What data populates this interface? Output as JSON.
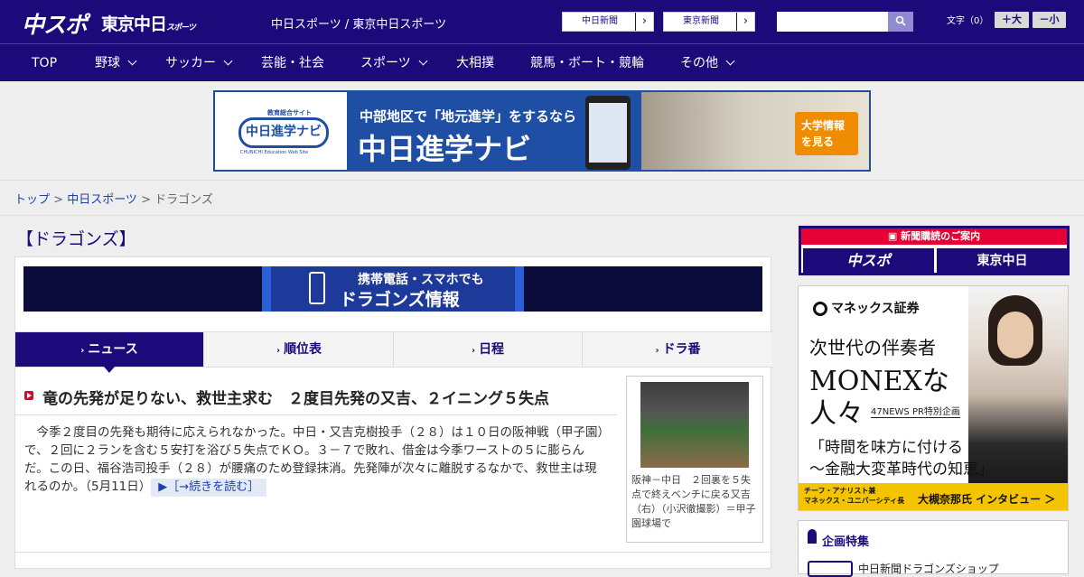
{
  "header": {
    "logo_chunichi": "中スポ",
    "logo_tokyo": "東京中日",
    "logo_tokyo_small": "スポーツ",
    "site_name": "中日スポーツ / 東京中日スポーツ",
    "btn_chunichi_shimbun": "中日新聞",
    "btn_tokyo_shimbun": "東京新聞",
    "search_placeholder": "",
    "text_size_label": "文字（0）",
    "text_bigger": "＋大",
    "text_smaller": "－小"
  },
  "nav": {
    "items": [
      {
        "label": "TOP"
      },
      {
        "label": "野球"
      },
      {
        "label": "サッカー"
      },
      {
        "label": "芸能・社会"
      },
      {
        "label": "スポーツ"
      },
      {
        "label": "大相撲"
      },
      {
        "label": "競馬・ボート・競輪"
      },
      {
        "label": "その他"
      }
    ]
  },
  "banner": {
    "logo": "中日進学ナビ",
    "logo_caption": "教育総合サイト",
    "logo_sub": "CHUNICHI Education Web Site",
    "catch": "中部地区で「地元進学」をするなら",
    "title": "中日進学ナビ",
    "cta": "大学情報\nを見る"
  },
  "breadcrumb": {
    "home": "トップ",
    "sep1": " > ",
    "section": "中日スポーツ",
    "sep2": " > ",
    "current": "ドラゴンズ"
  },
  "page_title": "【ドラゴンズ】",
  "mobile_banner": {
    "line1": "携帯電話・スマホでも",
    "line2": "ドラゴンズ情報"
  },
  "tabs": [
    {
      "label": "ニュース",
      "active": true
    },
    {
      "label": "順位表"
    },
    {
      "label": "日程"
    },
    {
      "label": "ドラ番"
    }
  ],
  "article": {
    "headline": "竜の先発が足りない、救世主求む　２度目先発の又吉、２イニング５失点",
    "body": "今季２度目の先発も期待に応えられなかった。中日・又吉克樹投手（２８）は１０日の阪神戦（甲子園）で、２回に２ランを含む５安打を浴び５失点でＫＯ。３－７で敗れ、借金は今季ワーストの５に膨らんだ。この日、福谷浩司投手（２８）が腰痛のため登録抹消。先発陣が次々に離脱するなかで、救世主は現れるのか。（5月11日）",
    "read_more": "［→続きを読む］",
    "photo_caption": "阪神－中日　２回裏を５失点で終えベンチに戻る又吉（右）（小沢徹撮影）＝甲子園球場で"
  },
  "sidebar": {
    "subscribe_head": "新聞購読のご案内",
    "subscribe_chuspo": "中スポ",
    "subscribe_tokyo": "東京中日",
    "ad": {
      "brand": "マネックス証券",
      "line1": "次世代の伴奏者",
      "line2": "MONEXな",
      "line3": "人々",
      "pr": "47NEWS PR特別企画",
      "quote1": "「時間を味方に付ける",
      "quote2": "〜金融大変革時代の知恵」",
      "role": "チーフ・アナリスト兼\nマネックス・ユニバーシティ長",
      "name": "大槻奈那氏 インタビュー ＞"
    },
    "feature_title": "企画特集",
    "feature_item": "中日新聞ドラゴンズショップ"
  },
  "colors": {
    "brand_navy": "#1c0a7a",
    "accent_red": "#e60033",
    "ad_yellow": "#f5c400"
  }
}
